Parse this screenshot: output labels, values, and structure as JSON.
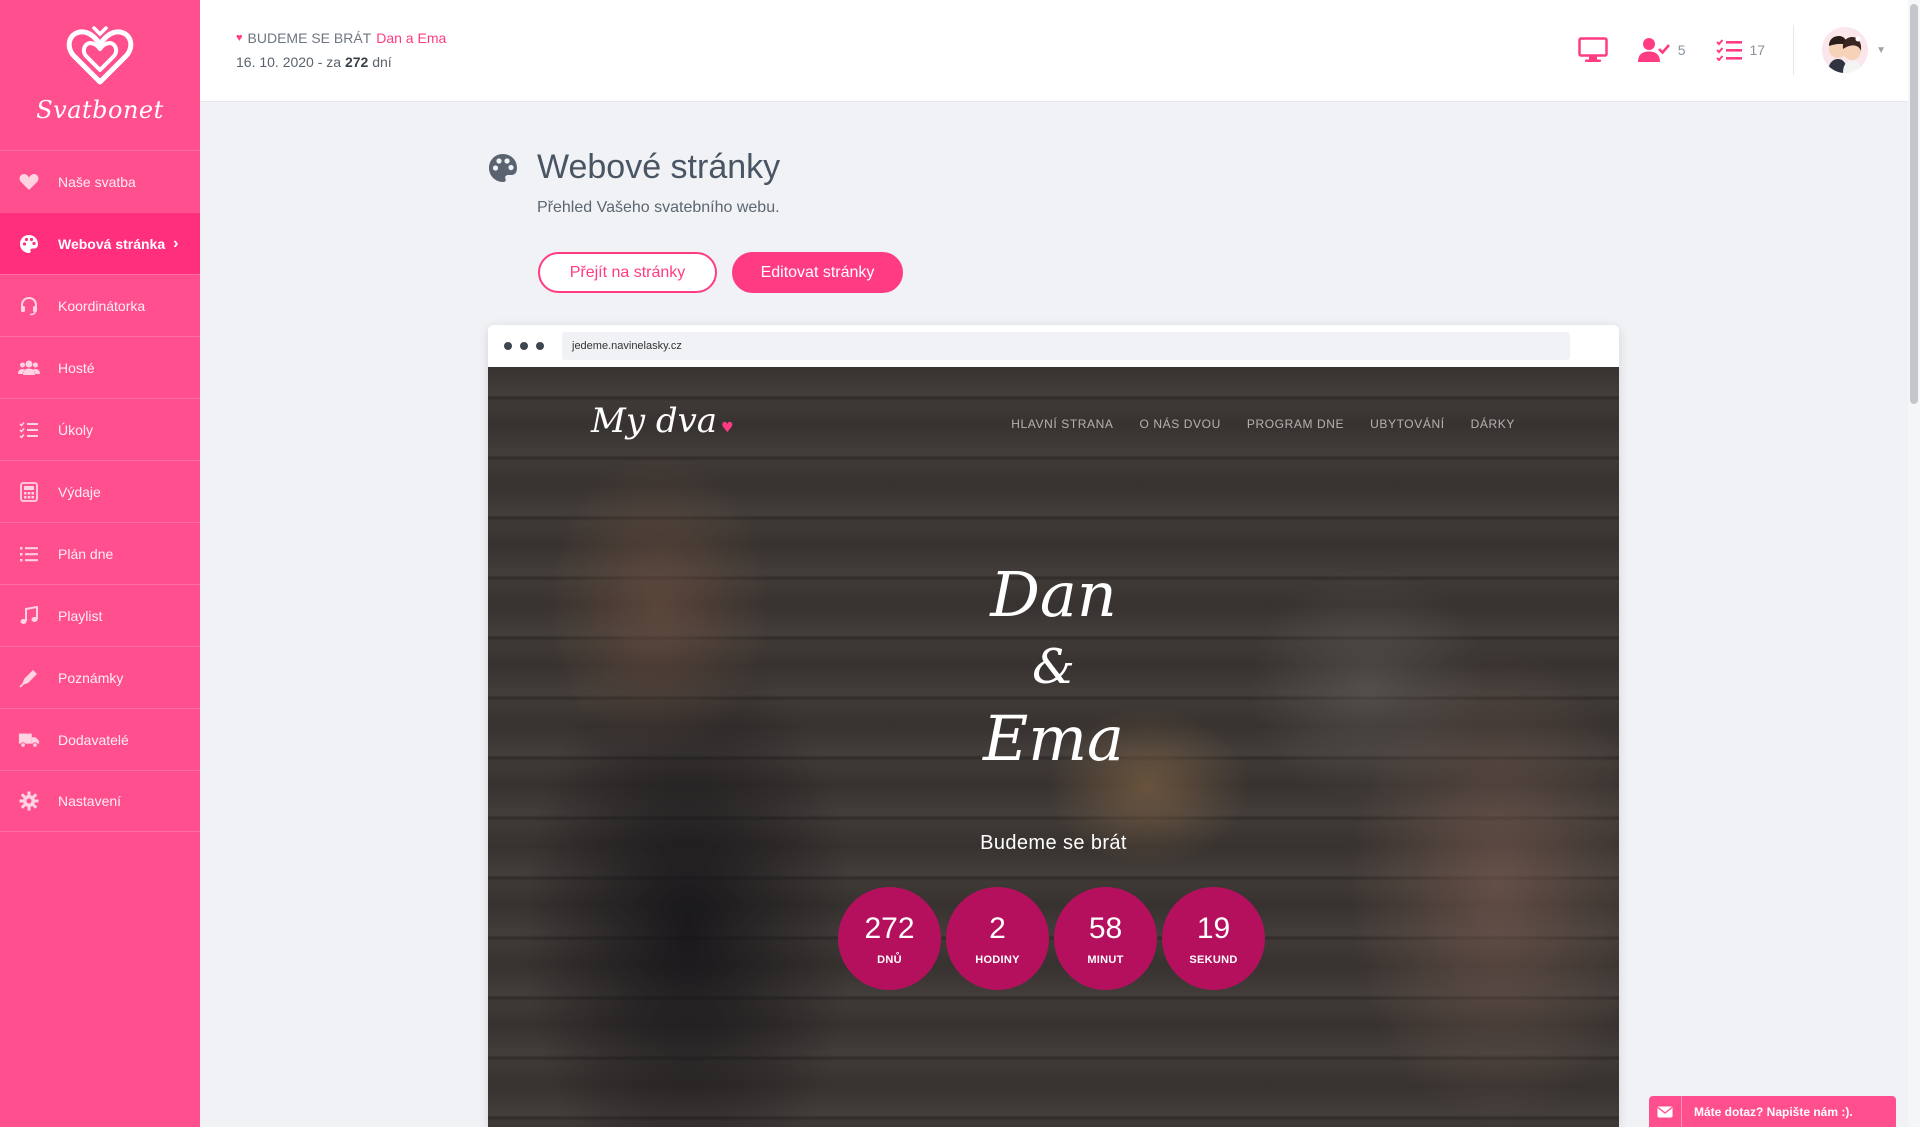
{
  "app": {
    "name": "Svatbonet"
  },
  "sidebar": {
    "items": [
      {
        "label": "Naše svatba",
        "icon": "heart-icon"
      },
      {
        "label": "Webová stránka",
        "icon": "palette-icon",
        "active": true
      },
      {
        "label": "Koordinátorka",
        "icon": "headset-icon"
      },
      {
        "label": "Hosté",
        "icon": "users-icon"
      },
      {
        "label": "Úkoly",
        "icon": "tasks-icon"
      },
      {
        "label": "Výdaje",
        "icon": "calculator-icon"
      },
      {
        "label": "Plán dne",
        "icon": "list-icon"
      },
      {
        "label": "Playlist",
        "icon": "music-icon"
      },
      {
        "label": "Poznámky",
        "icon": "pen-icon"
      },
      {
        "label": "Dodavatelé",
        "icon": "truck-icon"
      },
      {
        "label": "Nastavení",
        "icon": "gear-icon"
      }
    ]
  },
  "header": {
    "label": "BUDEME SE BRÁT",
    "names": "Dan a Ema",
    "date": "16. 10. 2020",
    "za": "- za",
    "days": "272",
    "days_suffix": "dní",
    "guests_count": "5",
    "tasks_count": "17"
  },
  "page": {
    "title": "Webové stránky",
    "subtitle": "Přehled Vašeho svatebního webu.",
    "btn_go": "Přejít na stránky",
    "btn_edit": "Editovat stránky"
  },
  "preview": {
    "url": "jedeme.navinelasky.cz",
    "logo": "My dva",
    "nav": [
      "HLAVNÍ STRANA",
      "O NÁS DVOU",
      "PROGRAM DNE",
      "UBYTOVÁNÍ",
      "DÁRKY"
    ],
    "name1": "Dan",
    "amp": "&",
    "name2": "Ema",
    "tagline": "Budeme se brát",
    "countdown": [
      {
        "value": "272",
        "unit": "DNŮ"
      },
      {
        "value": "2",
        "unit": "HODINY"
      },
      {
        "value": "58",
        "unit": "MINUT"
      },
      {
        "value": "19",
        "unit": "SEKUND"
      }
    ]
  },
  "chat": {
    "label": "Máte dotaz? Napište nám :)."
  },
  "colors": {
    "brand": "#ff4f8e",
    "accent": "#ff3b83",
    "countdown": "#b5105e"
  }
}
